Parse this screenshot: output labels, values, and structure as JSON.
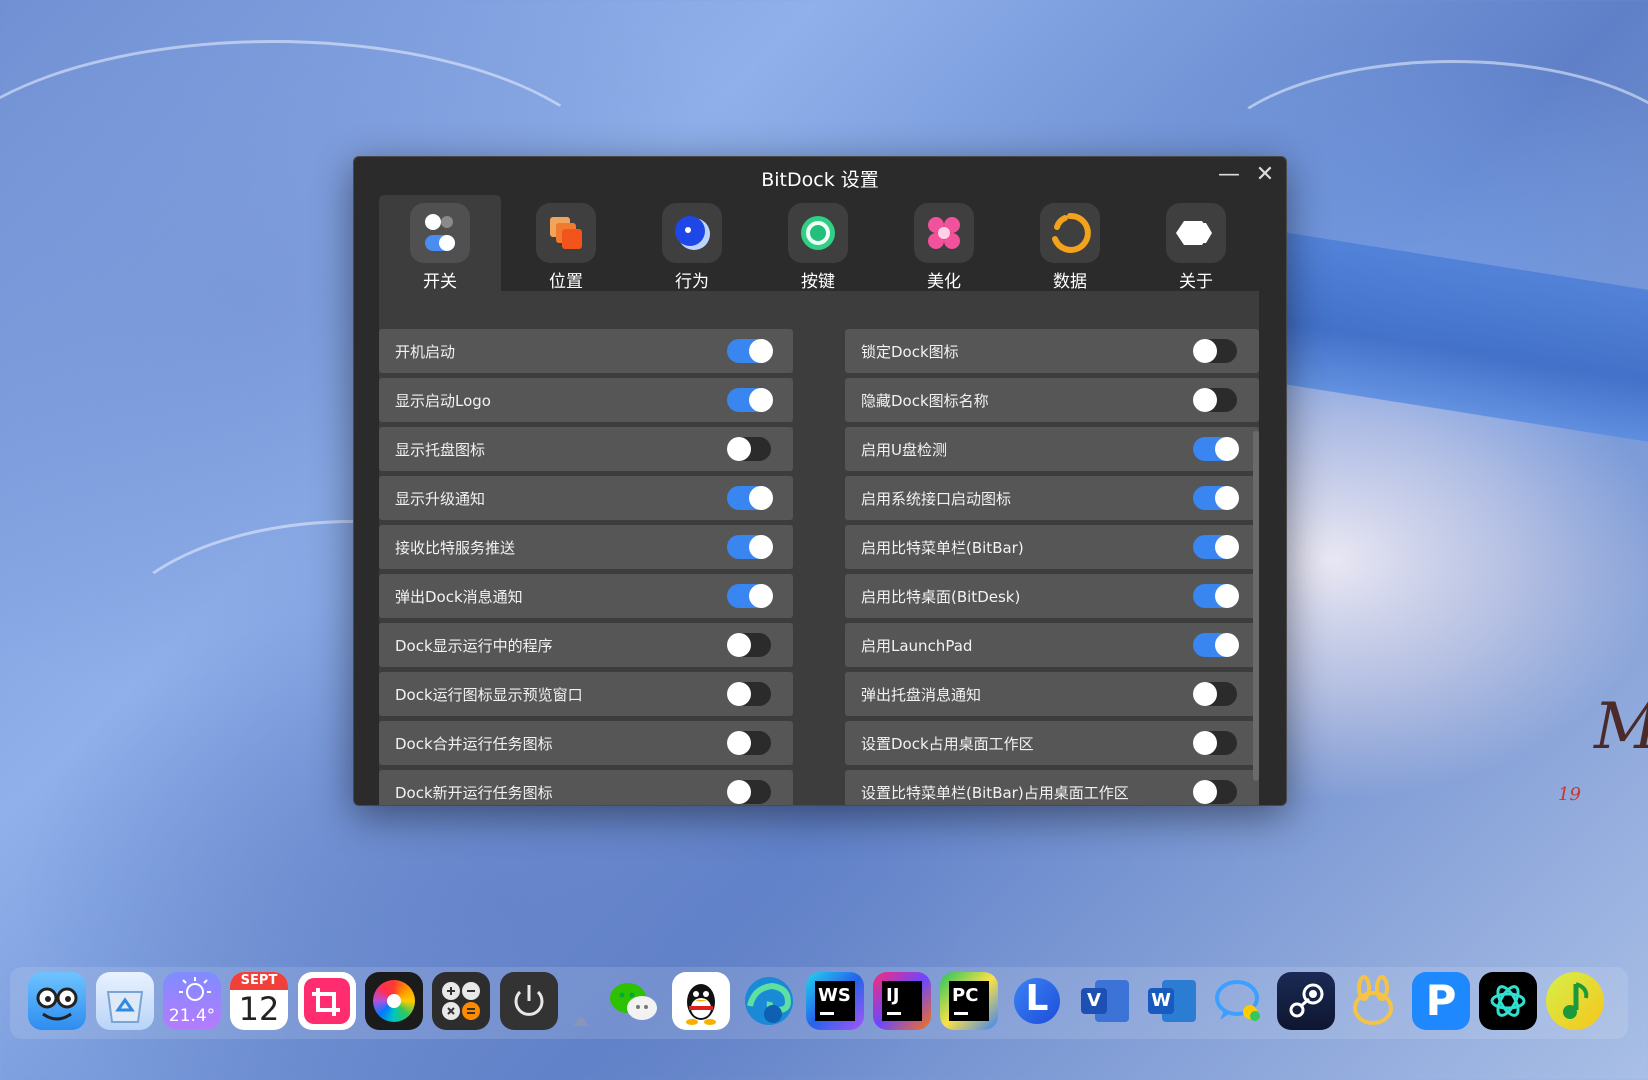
{
  "window": {
    "title": "BitDock 设置",
    "minimize_glyph": "—",
    "close_glyph": "✕"
  },
  "tabs": [
    {
      "label": "开关",
      "icon": "toggle-icon",
      "active": true
    },
    {
      "label": "位置",
      "icon": "layers-icon"
    },
    {
      "label": "行为",
      "icon": "moon-dot-icon"
    },
    {
      "label": "按键",
      "icon": "target-icon"
    },
    {
      "label": "美化",
      "icon": "flower-icon"
    },
    {
      "label": "数据",
      "icon": "refresh-ring-icon"
    },
    {
      "label": "关于",
      "icon": "hexagon-icon"
    }
  ],
  "settings_left": [
    {
      "label": "开机启动",
      "on": true
    },
    {
      "label": "显示启动Logo",
      "on": true
    },
    {
      "label": "显示托盘图标",
      "on": false
    },
    {
      "label": "显示升级通知",
      "on": true
    },
    {
      "label": "接收比特服务推送",
      "on": true
    },
    {
      "label": "弹出Dock消息通知",
      "on": true
    },
    {
      "label": "Dock显示运行中的程序",
      "on": false
    },
    {
      "label": "Dock运行图标显示预览窗口",
      "on": false
    },
    {
      "label": "Dock合并运行任务图标",
      "on": false
    },
    {
      "label": "Dock新开运行任务图标",
      "on": false
    }
  ],
  "settings_right": [
    {
      "label": "锁定Dock图标",
      "on": false
    },
    {
      "label": "隐藏Dock图标名称",
      "on": false
    },
    {
      "label": "启用U盘检测",
      "on": true
    },
    {
      "label": "启用系统接口启动图标",
      "on": true
    },
    {
      "label": "启用比特菜单栏(BitBar)",
      "on": true
    },
    {
      "label": "启用比特桌面(BitDesk)",
      "on": true
    },
    {
      "label": "启用LaunchPad",
      "on": true
    },
    {
      "label": "弹出托盘消息通知",
      "on": false
    },
    {
      "label": "设置Dock占用桌面工作区",
      "on": false
    },
    {
      "label": "设置比特菜单栏(BitBar)占用桌面工作区",
      "on": false
    }
  ],
  "dock": {
    "weather_temp": "21.4°",
    "calendar_month": "SEPT",
    "calendar_day": "12",
    "ws_label": "WS",
    "ij_label": "IJ",
    "pc_label": "PC",
    "v_label": "V",
    "w_label": "W",
    "p_label": "P",
    "l_label": "L"
  },
  "wallpaper": {
    "signature": "Mo",
    "number": "19"
  }
}
